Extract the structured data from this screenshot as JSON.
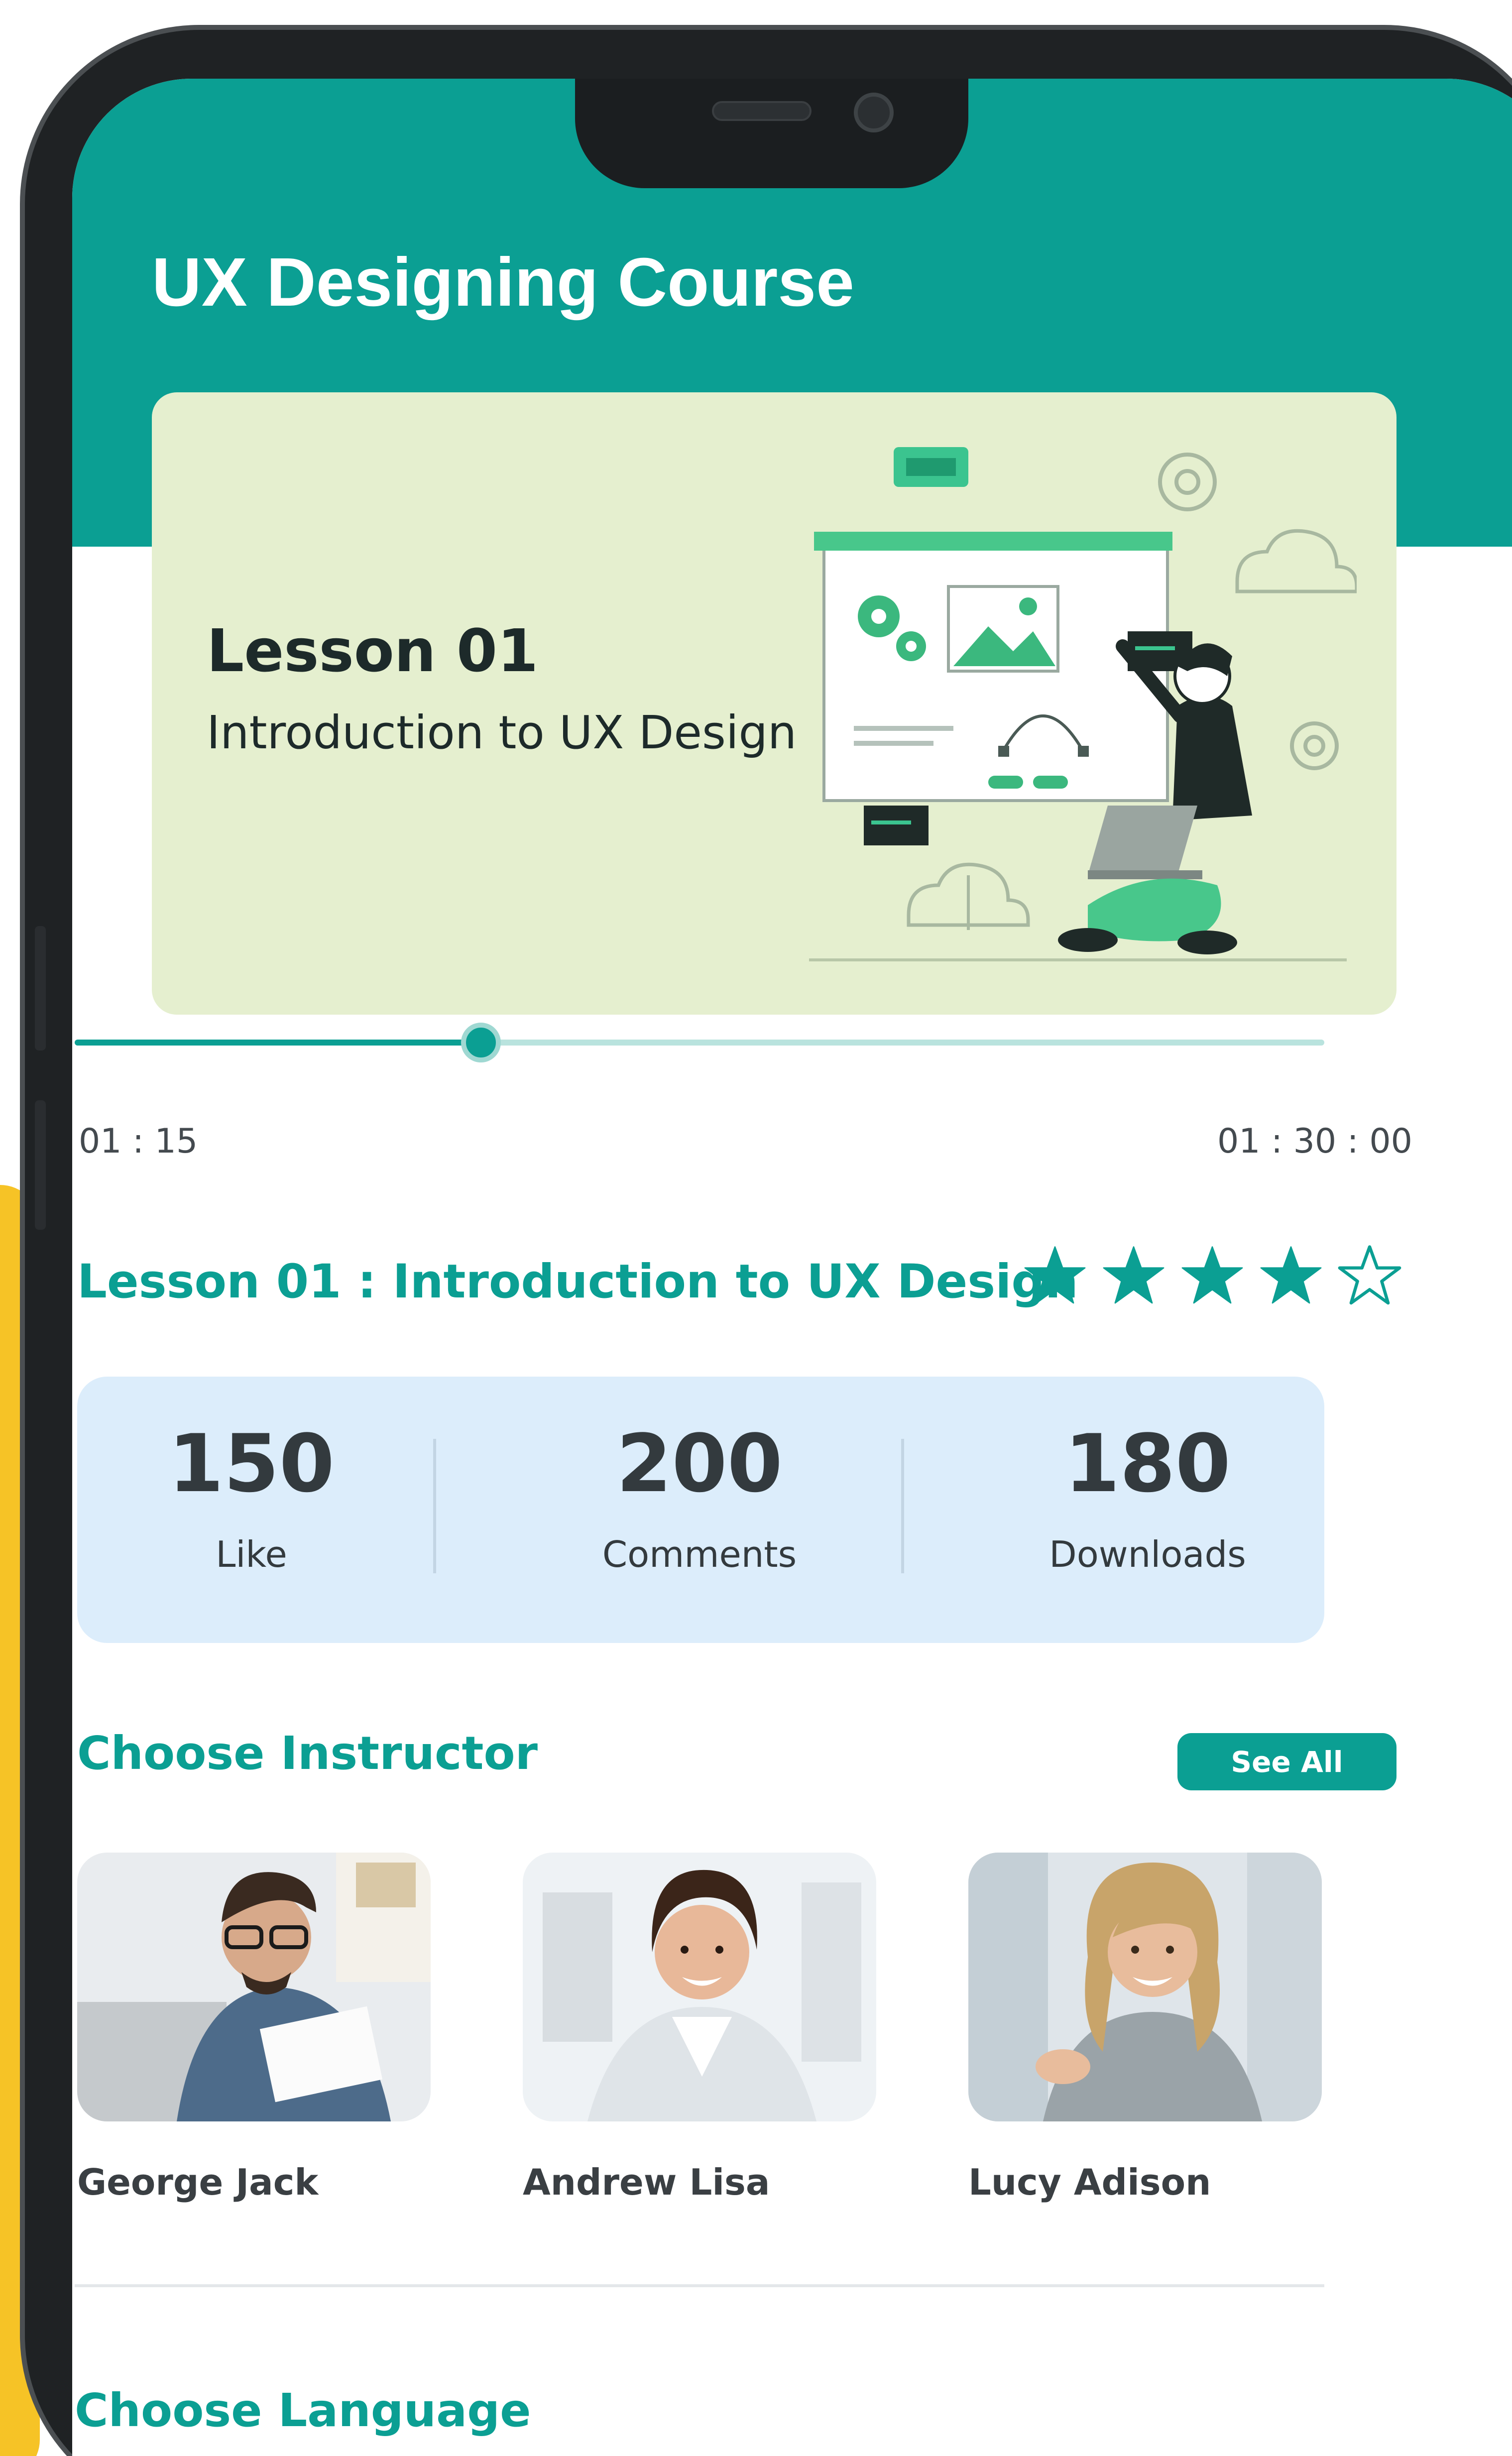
{
  "colors": {
    "accent": "#0b9f93",
    "card_green": "#e5efcf",
    "stats_bg": "#dcedfb",
    "frame": "#1f2224",
    "backdrop": "#f6c326"
  },
  "header": {
    "title": "UX Designing Course"
  },
  "lesson_card": {
    "number": "Lesson 01",
    "subtitle": "Introduction to UX Design",
    "illustration_icon": "designer-illustration"
  },
  "player": {
    "current_time": "01 : 15",
    "total_time": "01 : 30 : 00",
    "progress_fraction": 0.325
  },
  "lesson_info": {
    "heading": "Lesson 01 : Introduction to UX Design",
    "rating": 4,
    "rating_max": 5
  },
  "stats": [
    {
      "value": "150",
      "label": "Like"
    },
    {
      "value": "200",
      "label": "Comments"
    },
    {
      "value": "180",
      "label": "Downloads"
    }
  ],
  "instructors_section": {
    "title": "Choose Instructor",
    "see_all_label": "See All",
    "instructors": [
      {
        "name": "George Jack",
        "photo_icon": "man-with-glasses-photo"
      },
      {
        "name": "Andrew Lisa",
        "photo_icon": "smiling-woman-photo"
      },
      {
        "name": "Lucy Adison",
        "photo_icon": "blonde-woman-photo"
      }
    ]
  },
  "language_section": {
    "title": "Choose Language"
  }
}
